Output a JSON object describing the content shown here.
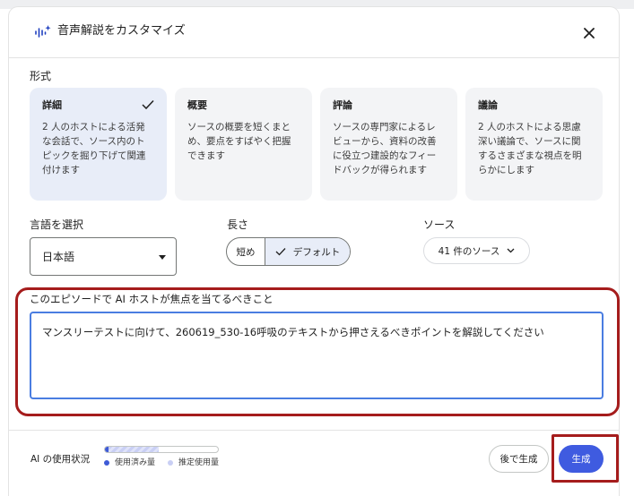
{
  "dialog": {
    "title": "音声解説をカスタマイズ",
    "title_icon": "audio-waveform-sparkle-icon",
    "close_icon": "close-icon"
  },
  "format": {
    "label": "形式",
    "cards": [
      {
        "title": "詳細",
        "desc": "2 人のホストによる活発な会話で、ソース内のトピックを掘り下げて関連付けます",
        "selected": true
      },
      {
        "title": "概要",
        "desc": "ソースの概要を短くまとめ、要点をすばやく把握できます",
        "selected": false
      },
      {
        "title": "評論",
        "desc": "ソースの専門家によるレビューから、資料の改善に役立つ建設的なフィードバックが得られます",
        "selected": false
      },
      {
        "title": "議論",
        "desc": "2 人のホストによる思慮深い議論で、ソースに関するさまざまな視点を明らかにします",
        "selected": false
      }
    ]
  },
  "language": {
    "label": "言語を選択",
    "value": "日本語"
  },
  "length": {
    "label": "長さ",
    "short_label": "短め",
    "default_label": "デフォルト",
    "selected": "default"
  },
  "source": {
    "label": "ソース",
    "button_label": "41 件のソース"
  },
  "focus": {
    "label": "このエピソードで AI ホストが焦点を当てるべきこと",
    "value": "マンスリーテストに向けて、260619_530-16呼吸のテキストから押さえるべきポイントを解説してください"
  },
  "usage": {
    "label": "AI の使用状況",
    "used_fraction": 0.03,
    "estimated_fraction": 0.48,
    "legend_used": "使用済み量",
    "legend_estimated": "推定使用量",
    "used_color": "#3e5bd6",
    "estimated_color": "#c9cff4"
  },
  "actions": {
    "later_label": "後で生成",
    "generate_label": "生成"
  },
  "colors": {
    "accent": "#3f5be0",
    "highlight": "#a51c1c",
    "selected_card": "#e8edf8"
  }
}
